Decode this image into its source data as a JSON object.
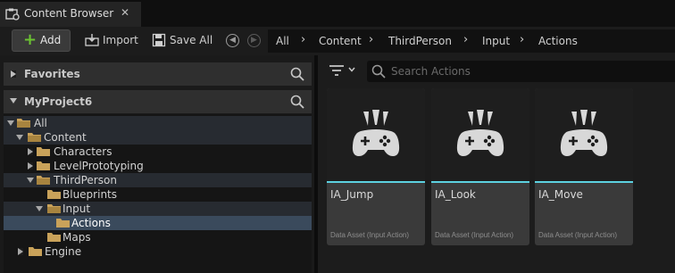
{
  "tab": {
    "title": "Content Browser",
    "close": "✕"
  },
  "toolbar": {
    "add_label": "Add",
    "import_label": "Import",
    "save_all_label": "Save All"
  },
  "breadcrumbs": [
    "All",
    "Content",
    "ThirdPerson",
    "Input",
    "Actions"
  ],
  "favorites": {
    "title": "Favorites"
  },
  "project": {
    "title": "MyProject6"
  },
  "tree": [
    {
      "label": "All",
      "expanded": true
    },
    {
      "label": "Content",
      "expanded": true
    },
    {
      "label": "Characters",
      "expanded": false
    },
    {
      "label": "LevelPrototyping",
      "expanded": false
    },
    {
      "label": "ThirdPerson",
      "expanded": true
    },
    {
      "label": "Blueprints"
    },
    {
      "label": "Input",
      "expanded": true
    },
    {
      "label": "Actions",
      "selected": true
    },
    {
      "label": "Maps"
    },
    {
      "label": "Engine",
      "expanded": false
    }
  ],
  "search": {
    "placeholder": "Search Actions"
  },
  "assets": [
    {
      "name": "IA_Jump",
      "type": "Data Asset (Input Action)"
    },
    {
      "name": "IA_Look",
      "type": "Data Asset (Input Action)"
    },
    {
      "name": "IA_Move",
      "type": "Data Asset (Input Action)"
    }
  ],
  "colors": {
    "accent_bar": "#5cd1e0",
    "add_plus": "#6bc232",
    "folder": "#c9a25a",
    "selection": "#3a4a5c"
  },
  "icons": [
    "content-browser-icon",
    "plus-icon",
    "import-icon",
    "save-icon",
    "back-icon",
    "forward-icon",
    "search-icon",
    "filter-icon",
    "folder-icon",
    "gamepad-icon"
  ]
}
